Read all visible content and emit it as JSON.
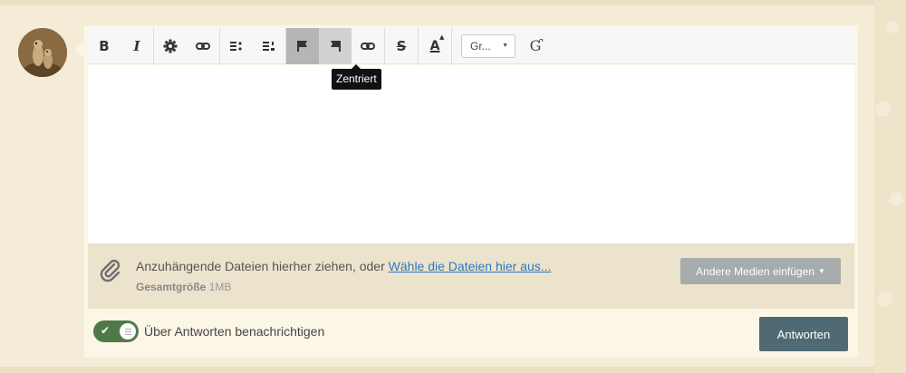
{
  "toolbar": {
    "bold_icon": "B",
    "italic_icon": "I",
    "strike_icon": "S",
    "color_icon": "A",
    "font_select_value": "Gr...",
    "paragraph_icon": "Ɠ",
    "tooltip": "Zentriert"
  },
  "attachments": {
    "text": "Anzuhängende Dateien hierher ziehen, oder",
    "link": "Wähle die Dateien hier aus...",
    "size_label": "Gesamtgröße",
    "size_value": "1MB",
    "media_button": "Andere Medien einfügen"
  },
  "footer": {
    "notify_label": "Über Antworten benachrichtigen",
    "notify_enabled": true,
    "reply_button": "Antworten"
  },
  "colors": {
    "reply_button": "#4f6a72",
    "toggle_on": "#4f7a48",
    "link": "#2b79c2"
  }
}
